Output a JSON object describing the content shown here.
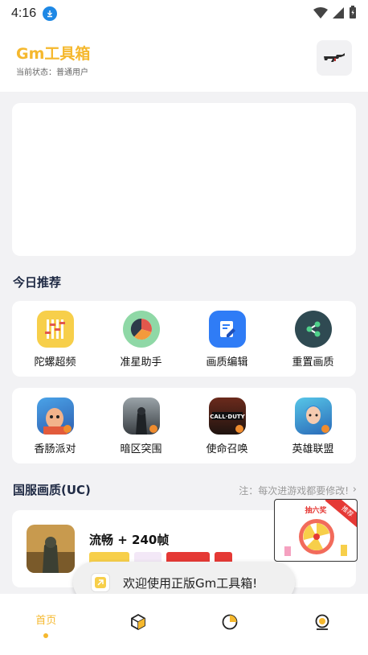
{
  "status_bar": {
    "time": "4:16"
  },
  "header": {
    "title": "Gm工具箱",
    "subtitle": "当前状态：普通用户"
  },
  "today": {
    "title": "今日推荐",
    "tools": [
      {
        "label": "陀螺超频",
        "icon": "tuning-bars-icon"
      },
      {
        "label": "准星助手",
        "icon": "pie-chart-icon"
      },
      {
        "label": "画质编辑",
        "icon": "edit-document-icon"
      },
      {
        "label": "重置画质",
        "icon": "share-nodes-icon"
      }
    ],
    "games": [
      {
        "label": "香肠派对",
        "icon": "sausage-party-game-icon"
      },
      {
        "label": "暗区突围",
        "icon": "arena-breakout-game-icon"
      },
      {
        "label": "使命召唤",
        "icon": "call-of-duty-game-icon"
      },
      {
        "label": "英雄联盟",
        "icon": "league-of-legends-game-icon"
      }
    ],
    "cod_text": "CALL·DUTY"
  },
  "uc": {
    "title": "国服画质(UC)",
    "note": "注：每次进游戏都要修改!"
  },
  "game_card": {
    "name": "流畅 + 240帧"
  },
  "lottery": {
    "title": "抽六奖",
    "ribbon": "推荐"
  },
  "toast": {
    "message": "欢迎使用正版Gm工具箱!"
  },
  "bottom_nav": {
    "home_label": "首页"
  },
  "colors": {
    "accent": "#f5b82e",
    "title_dark": "#1f2a44"
  }
}
